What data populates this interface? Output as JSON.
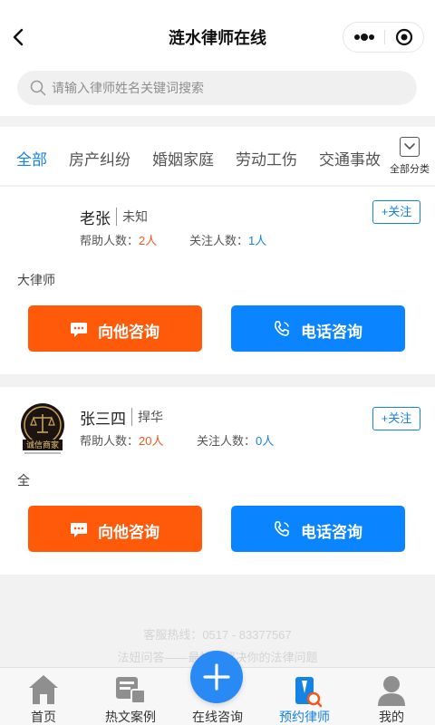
{
  "nav": {
    "title": "涟水律师在线"
  },
  "search": {
    "placeholder": "请输入律师姓名关键词搜索"
  },
  "tabs": {
    "items": [
      "全部",
      "房产纠纷",
      "婚姻家庭",
      "劳动工伤",
      "交通事故"
    ],
    "active": "全部",
    "all_categories_label": "全部分类"
  },
  "lawyers": [
    {
      "name": "老张",
      "firm": "未知",
      "help_label": "帮助人数：",
      "help_count": "2人",
      "follow_label": "关注人数：",
      "follow_count": "1人",
      "follow_button": "+关注",
      "title": "大律师",
      "consult_button": "向他咨询",
      "phone_button": "电话咨询",
      "has_avatar": false
    },
    {
      "name": "张三四",
      "firm": "捍华",
      "help_label": "帮助人数：",
      "help_count": "20人",
      "follow_label": "关注人数：",
      "follow_count": "0人",
      "follow_button": "+关注",
      "title": "全",
      "consult_button": "向他咨询",
      "phone_button": "电话咨询",
      "has_avatar": true,
      "avatar_text": "诚信商家"
    }
  ],
  "footer": {
    "hotline": "客服热线：0517 - 83377567",
    "slogan": "法妞问答——最快速解决你的法律问题"
  },
  "tabbar": {
    "items": [
      {
        "label": "首页",
        "icon": "home-icon"
      },
      {
        "label": "热文案例",
        "icon": "articles-icon"
      },
      {
        "label": "在线咨询",
        "icon": "plus-icon"
      },
      {
        "label": "预约律师",
        "icon": "lawyer-icon"
      },
      {
        "label": "我的",
        "icon": "user-icon"
      }
    ],
    "active": "预约律师"
  },
  "colors": {
    "accent": "#1582e6",
    "orange": "#ff5a0a",
    "blue_button": "#0a84ff"
  }
}
